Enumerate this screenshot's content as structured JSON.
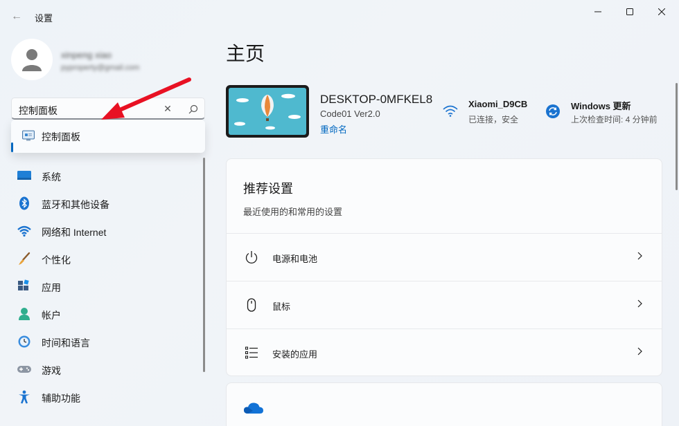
{
  "window": {
    "title": "设置",
    "back_glyph": "←"
  },
  "profile": {
    "name": "xinpeng xiao",
    "email": "pyproperty@gmail.com"
  },
  "search": {
    "value": "控制面板",
    "suggestion": "控制面板"
  },
  "sidebar": {
    "items": [
      {
        "label": "系统",
        "icon": "system-icon"
      },
      {
        "label": "蓝牙和其他设备",
        "icon": "bluetooth-icon"
      },
      {
        "label": "网络和 Internet",
        "icon": "wifi-icon"
      },
      {
        "label": "个性化",
        "icon": "brush-icon"
      },
      {
        "label": "应用",
        "icon": "apps-icon"
      },
      {
        "label": "帐户",
        "icon": "account-icon"
      },
      {
        "label": "时间和语言",
        "icon": "clock-globe-icon"
      },
      {
        "label": "游戏",
        "icon": "gamepad-icon"
      },
      {
        "label": "辅助功能",
        "icon": "accessibility-icon"
      }
    ]
  },
  "main": {
    "title": "主页",
    "device": {
      "name": "DESKTOP-0MFKEL8",
      "model": "Code01 Ver2.0",
      "rename": "重命名"
    },
    "wifi": {
      "name": "Xiaomi_D9CB",
      "status": "已连接，安全"
    },
    "update": {
      "title": "Windows 更新",
      "status": "上次检查时间: 4 分钟前"
    },
    "recommended": {
      "title": "推荐设置",
      "subtitle": "最近使用的和常用的设置",
      "items": [
        {
          "label": "电源和电池",
          "icon": "power-icon"
        },
        {
          "label": "鼠标",
          "icon": "mouse-icon"
        },
        {
          "label": "安装的应用",
          "icon": "list-icon"
        }
      ]
    }
  },
  "colors": {
    "accent": "#0067c0",
    "annotation_arrow": "#e81123"
  }
}
